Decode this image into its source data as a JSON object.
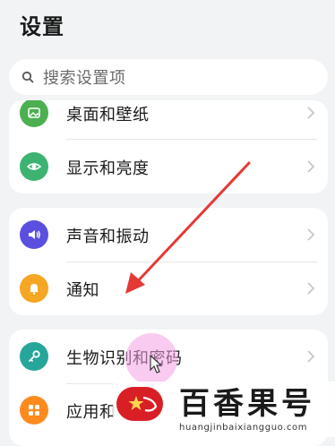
{
  "page": {
    "title": "设置"
  },
  "search": {
    "placeholder": "搜索设置项",
    "icon": "search-icon"
  },
  "groups": [
    {
      "items": [
        {
          "label": "桌面和壁纸",
          "icon": "wallpaper-icon",
          "color": "#4caf50"
        },
        {
          "label": "显示和亮度",
          "icon": "eye-icon",
          "color": "#3cb371"
        }
      ]
    },
    {
      "items": [
        {
          "label": "声音和振动",
          "icon": "volume-icon",
          "color": "#5b4fe0"
        },
        {
          "label": "通知",
          "icon": "bell-icon",
          "color": "#f5a623"
        }
      ]
    },
    {
      "items": [
        {
          "label": "生物识别和密码",
          "icon": "key-icon",
          "color": "#26a69a"
        },
        {
          "label": "应用和",
          "icon": "apps-icon",
          "color": "#ff8a1e"
        }
      ]
    }
  ],
  "annotation": {
    "arrow_color": "#e53935"
  },
  "watermark": {
    "text": "百香果号",
    "url": "huangjinbaixiangguo.com",
    "logo_color": "#d91f26"
  }
}
